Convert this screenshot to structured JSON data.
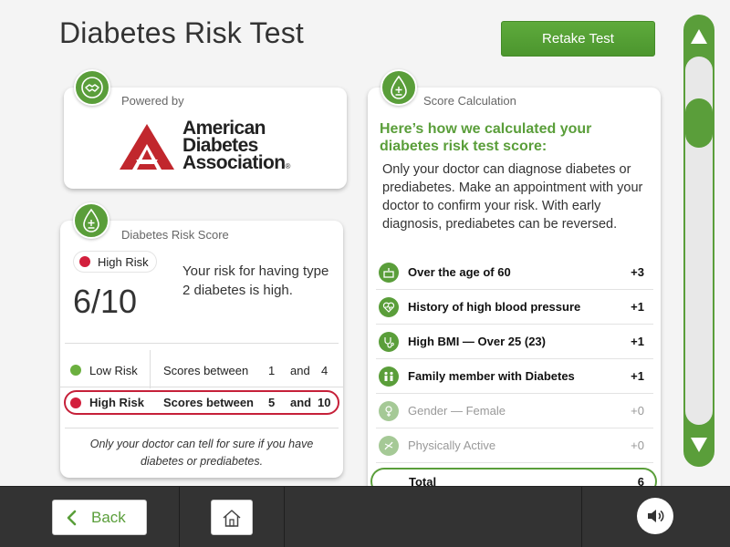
{
  "header": {
    "title": "Diabetes Risk Test",
    "retake_label": "Retake Test"
  },
  "powered": {
    "caption": "Powered by",
    "logo_line1": "American",
    "logo_line2": "Diabetes",
    "logo_line3": "Association",
    "logo_mark": "®"
  },
  "risk": {
    "caption": "Diabetes Risk Score",
    "level_label": "High Risk",
    "score": "6/10",
    "message": "Your risk for having type 2 diabetes is high.",
    "ranges": [
      {
        "label": "Low Risk",
        "scores": "Scores between",
        "min": "1",
        "and": "and",
        "max": "4",
        "color": "#6bb03f"
      },
      {
        "label": "High Risk",
        "scores": "Scores between",
        "min": "5",
        "and": "and",
        "max": "10",
        "color": "#d21f3c"
      }
    ],
    "note": "Only your doctor can tell for sure if you have diabetes or prediabetes."
  },
  "calc": {
    "caption": "Score Calculation",
    "heading": "Here’s how we calculated your diabetes risk test score:",
    "body": "Only your doctor can diagnose diabetes or prediabetes. Make an appointment with your doctor to confirm your risk. With early diagnosis, prediabetes can be reversed.",
    "factors": [
      {
        "label": "Over the age of 60",
        "points": "+3",
        "icon": "birthday-cake-icon",
        "active": true
      },
      {
        "label": "History of high blood pressure",
        "points": "+1",
        "icon": "heart-pulse-icon",
        "active": true
      },
      {
        "label": "High BMI — Over 25 (23)",
        "points": "+1",
        "icon": "stethoscope-icon",
        "active": true
      },
      {
        "label": "Family member with Diabetes",
        "points": "+1",
        "icon": "family-icon",
        "active": true
      },
      {
        "label": "Gender — Female",
        "points": "+0",
        "icon": "gender-icon",
        "active": false
      },
      {
        "label": "Physically Active",
        "points": "+0",
        "icon": "activity-icon",
        "active": false
      }
    ],
    "total_label": "Total",
    "total_value": "6"
  },
  "nav": {
    "back_label": "Back"
  },
  "colors": {
    "accent": "#5a9e3a",
    "high_risk": "#d21f3c",
    "low_risk": "#6bb03f",
    "bottom_bar": "#333333"
  }
}
